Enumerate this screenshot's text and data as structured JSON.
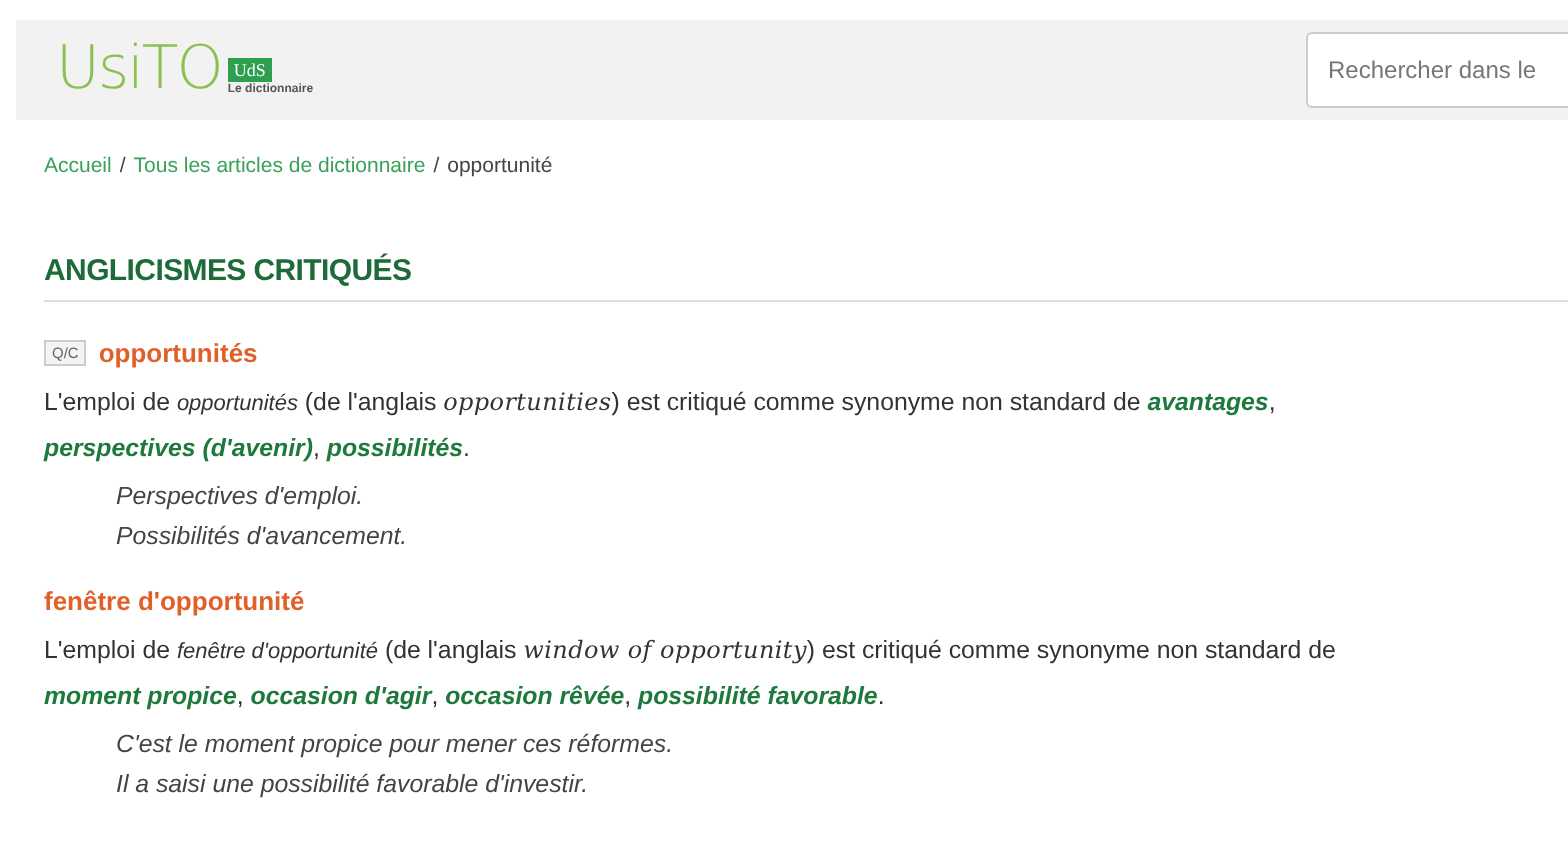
{
  "header": {
    "logo": {
      "word": "UsiTO",
      "badge": "UdS",
      "tagline": "Le dictionnaire"
    },
    "search": {
      "placeholder": "Rechercher dans le"
    }
  },
  "breadcrumb_separator": "/",
  "breadcrumb": [
    {
      "label": "Accueil",
      "kind": "link"
    },
    {
      "label": "Tous les articles de dictionnaire",
      "kind": "link"
    },
    {
      "label": "opportunité",
      "kind": "current"
    }
  ],
  "section": {
    "title": "ANGLICISMES CRITIQUÉS",
    "entries": [
      {
        "tag": "Q/C",
        "term": "opportunités",
        "paragraph": [
          {
            "kind": "plain",
            "text": "L'emploi de "
          },
          {
            "kind": "term",
            "text": "opportunités"
          },
          {
            "kind": "plain",
            "text": " (de l'anglais "
          },
          {
            "kind": "english",
            "text": "opportunities"
          },
          {
            "kind": "plain",
            "text": ") est critiqué comme synonyme non standard de "
          },
          {
            "kind": "synonym",
            "text": "avantages"
          },
          {
            "kind": "plain",
            "text": ", "
          },
          {
            "kind": "synonym",
            "text": "perspectives (d'avenir)"
          },
          {
            "kind": "plain",
            "text": ", "
          },
          {
            "kind": "synonym",
            "text": "possibilités"
          },
          {
            "kind": "plain",
            "text": "."
          }
        ],
        "examples": [
          "Perspectives d'emploi.",
          "Possibilités d'avancement."
        ]
      },
      {
        "term": "fenêtre d'opportunité",
        "paragraph": [
          {
            "kind": "plain",
            "text": "L'emploi de "
          },
          {
            "kind": "term",
            "text": "fenêtre d'opportunité"
          },
          {
            "kind": "plain",
            "text": " (de l'anglais "
          },
          {
            "kind": "english",
            "text": "window of opportunity"
          },
          {
            "kind": "plain",
            "text": ") est critiqué comme synonyme non standard de "
          },
          {
            "kind": "synonym",
            "text": "moment propice"
          },
          {
            "kind": "plain",
            "text": ", "
          },
          {
            "kind": "synonym",
            "text": "occasion d'agir"
          },
          {
            "kind": "plain",
            "text": ", "
          },
          {
            "kind": "synonym",
            "text": "occasion rêvée"
          },
          {
            "kind": "plain",
            "text": ", "
          },
          {
            "kind": "synonym",
            "text": "possibilité favorable"
          },
          {
            "kind": "plain",
            "text": "."
          }
        ],
        "examples": [
          "C'est le moment propice pour mener ces réformes.",
          "Il a saisi une possibilité favorable d'investir."
        ]
      }
    ]
  }
}
